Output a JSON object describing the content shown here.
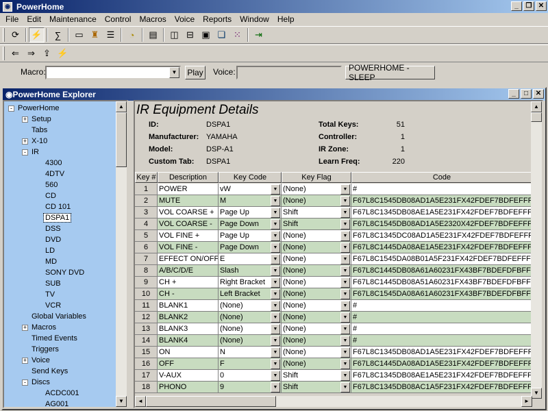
{
  "app": {
    "title": "PowerHome"
  },
  "menu": [
    "File",
    "Edit",
    "Maintenance",
    "Control",
    "Macros",
    "Voice",
    "Reports",
    "Window",
    "Help"
  ],
  "macrobar": {
    "macro_label": "Macro:",
    "macro_value": "",
    "play_label": "Play",
    "voice_label": "Voice:",
    "voice_value": "",
    "status_button": "POWERHOME - SLEEP"
  },
  "explorer": {
    "title": "PowerHome Explorer",
    "tree": [
      {
        "label": "PowerHome",
        "level": 0,
        "exp": "-"
      },
      {
        "label": "Setup",
        "level": 1,
        "exp": "+"
      },
      {
        "label": "Tabs",
        "level": 1,
        "exp": ""
      },
      {
        "label": "X-10",
        "level": 1,
        "exp": "+"
      },
      {
        "label": "IR",
        "level": 1,
        "exp": "-"
      },
      {
        "label": "4300",
        "level": 2,
        "exp": ""
      },
      {
        "label": "4DTV",
        "level": 2,
        "exp": ""
      },
      {
        "label": "560",
        "level": 2,
        "exp": ""
      },
      {
        "label": "CD",
        "level": 2,
        "exp": ""
      },
      {
        "label": "CD 101",
        "level": 2,
        "exp": ""
      },
      {
        "label": "DSPA1",
        "level": 2,
        "exp": "",
        "selected": true
      },
      {
        "label": "DSS",
        "level": 2,
        "exp": ""
      },
      {
        "label": "DVD",
        "level": 2,
        "exp": ""
      },
      {
        "label": "LD",
        "level": 2,
        "exp": ""
      },
      {
        "label": "MD",
        "level": 2,
        "exp": ""
      },
      {
        "label": "SONY DVD",
        "level": 2,
        "exp": ""
      },
      {
        "label": "SUB",
        "level": 2,
        "exp": ""
      },
      {
        "label": "TV",
        "level": 2,
        "exp": ""
      },
      {
        "label": "VCR",
        "level": 2,
        "exp": ""
      },
      {
        "label": "Global Variables",
        "level": 1,
        "exp": ""
      },
      {
        "label": "Macros",
        "level": 1,
        "exp": "+"
      },
      {
        "label": "Timed Events",
        "level": 1,
        "exp": ""
      },
      {
        "label": "Triggers",
        "level": 1,
        "exp": ""
      },
      {
        "label": "Voice",
        "level": 1,
        "exp": "+"
      },
      {
        "label": "Send Keys",
        "level": 1,
        "exp": ""
      },
      {
        "label": "Discs",
        "level": 1,
        "exp": "-"
      },
      {
        "label": "ACDC001",
        "level": 2,
        "exp": ""
      },
      {
        "label": "AG001",
        "level": 2,
        "exp": ""
      }
    ]
  },
  "details": {
    "heading": "IR Equipment Details",
    "left": [
      {
        "label": "ID:",
        "value": "DSPA1"
      },
      {
        "label": "Manufacturer:",
        "value": "YAMAHA"
      },
      {
        "label": "Model:",
        "value": "DSP-A1"
      },
      {
        "label": "Custom Tab:",
        "value": "DSPA1"
      }
    ],
    "right": [
      {
        "label": "Total Keys:",
        "value": "51"
      },
      {
        "label": "Controller:",
        "value": "1"
      },
      {
        "label": "IR Zone:",
        "value": "1"
      },
      {
        "label": "Learn Freq:",
        "value": "220"
      }
    ],
    "columns": [
      "Key #",
      "Description",
      "Key Code",
      "Key Flag",
      "Code"
    ],
    "rows": [
      {
        "num": "1",
        "desc": "POWER",
        "keycode": "vW",
        "flag": "(None)",
        "code": "#"
      },
      {
        "num": "2",
        "desc": "MUTE",
        "keycode": "M",
        "flag": "(None)",
        "code": "F67L8C1545DB08AD1A5E231FX42FDEF7BDFEFFFDF"
      },
      {
        "num": "3",
        "desc": "VOL COARSE +",
        "keycode": "Page Up",
        "flag": "Shift",
        "code": "F67L8C1345DB08AE1A5E231FX42FDEF7BDFEFFFDF"
      },
      {
        "num": "4",
        "desc": "VOL COARSE -",
        "keycode": "Page Down",
        "flag": "Shift",
        "code": "F67L8C1545DB08AD1A5E2320X42FDEF7BDFEFFFDF"
      },
      {
        "num": "5",
        "desc": "VOL FINE +",
        "keycode": "Page Up",
        "flag": "(None)",
        "code": "F67L8C1345DC08AD1A5E231FX42FDEF7BDFEFFFDF"
      },
      {
        "num": "6",
        "desc": "VOL FINE -",
        "keycode": "Page Down",
        "flag": "(None)",
        "code": "F67L8C1445DA08AE1A5E231FX42FDEF7BDFEFFFDF"
      },
      {
        "num": "7",
        "desc": "EFFECT ON/OFF",
        "keycode": "E",
        "flag": "(None)",
        "code": "F67L8C1545DA08B01A5F231FX42FDEF7BDFEFFFDF"
      },
      {
        "num": "8",
        "desc": "A/B/C/D/E",
        "keycode": "Slash",
        "flag": "(None)",
        "code": "F67L8C1445DB08A61A60231FX43BF7BDEFDFBFFDF"
      },
      {
        "num": "9",
        "desc": "CH +",
        "keycode": "Right Bracket",
        "flag": "(None)",
        "code": "F67L8C1445DB08A51A60231FX43BF7BDEFDFBFFDF"
      },
      {
        "num": "10",
        "desc": "CH -",
        "keycode": "Left Bracket",
        "flag": "(None)",
        "code": "F67L8C1545DA08A61A60231FX43BF7BDEFDFBFFDF"
      },
      {
        "num": "11",
        "desc": "BLANK1",
        "keycode": "(None)",
        "flag": "(None)",
        "code": "#"
      },
      {
        "num": "12",
        "desc": "BLANK2",
        "keycode": "(None)",
        "flag": "(None)",
        "code": "#"
      },
      {
        "num": "13",
        "desc": "BLANK3",
        "keycode": "(None)",
        "flag": "(None)",
        "code": "#"
      },
      {
        "num": "14",
        "desc": "BLANK4",
        "keycode": "(None)",
        "flag": "(None)",
        "code": "#"
      },
      {
        "num": "15",
        "desc": "ON",
        "keycode": "N",
        "flag": "(None)",
        "code": "F67L8C1345DB08AD1A5E231FX42FDEF7BDFEFFFDF"
      },
      {
        "num": "16",
        "desc": "OFF",
        "keycode": "F",
        "flag": "(None)",
        "code": "F67L8C1445DA08AD1A5E231FX42FDEF7BDFEFFFDF"
      },
      {
        "num": "17",
        "desc": "V-AUX",
        "keycode": "0",
        "flag": "Shift",
        "code": "F67L8C1345DB08AE1A5E231FX42FDEF7BDFEFFFDF"
      },
      {
        "num": "18",
        "desc": "PHONO",
        "keycode": "9",
        "flag": "Shift",
        "code": "F67L8C1345DB08AC1A5F231FX42FDEF7BDFEFFFDF"
      }
    ]
  },
  "colors": {
    "title_start": "#0a246a",
    "title_end": "#a6caf0",
    "tree_bg": "#a6caf0",
    "row_alt": "#c8dcc0",
    "row_white": "#ffffff"
  }
}
